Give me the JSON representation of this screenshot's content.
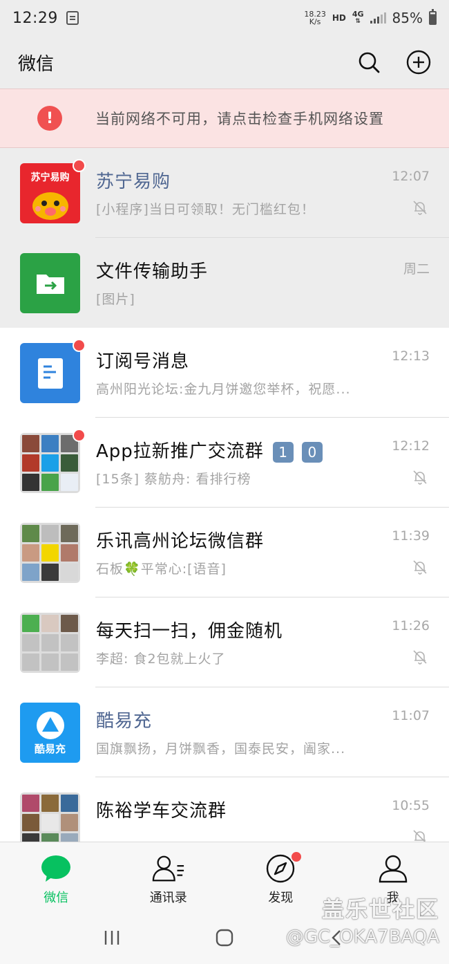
{
  "status_bar": {
    "time": "12:29",
    "net_speed_value": "18.23",
    "net_speed_unit": "K/s",
    "hd": "HD",
    "network": "4G",
    "battery": "85%"
  },
  "header": {
    "title": "微信",
    "search_icon": "search-icon",
    "add_icon": "plus-circle-icon"
  },
  "alert": {
    "icon": "exclamation-icon",
    "color": "#f05151",
    "text": "当前网络不可用，请点击检查手机网络设置"
  },
  "chats": [
    {
      "name": "苏宁易购",
      "preview": "[小程序]当日可领取！无门槛红包！",
      "time": "12:07",
      "pinned": true,
      "unread_dot": true,
      "muted": true,
      "name_color": "blue",
      "avatar_text": "苏宁易购",
      "avatar_color": "#e8262d"
    },
    {
      "name": "文件传输助手",
      "preview": "[图片]",
      "time": "周二",
      "pinned": true,
      "unread_dot": false,
      "muted": false,
      "avatar_color": "#2ba245"
    },
    {
      "name": "订阅号消息",
      "preview": "高州阳光论坛:金九月饼邀您举杯，祝愿...",
      "time": "12:13",
      "pinned": false,
      "unread_dot": true,
      "muted": false,
      "avatar_color": "#2f83dd"
    },
    {
      "name": "App拉新推广交流群",
      "badges": [
        "1",
        "0"
      ],
      "preview": "[15条] 蔡舫舟: 看排行榜",
      "time": "12:12",
      "pinned": false,
      "unread_dot": true,
      "muted": true
    },
    {
      "name": "乐讯高州论坛微信群",
      "preview_before": "石板",
      "preview_after": "平常心:[语音]",
      "time": "11:39",
      "pinned": false,
      "unread_dot": false,
      "muted": true
    },
    {
      "name": "每天扫一扫，佣金随机",
      "preview": "李超: 食2包就上火了",
      "time": "11:26",
      "pinned": false,
      "unread_dot": false,
      "muted": true
    },
    {
      "name": "酷易充",
      "preview": "国旗飘扬，月饼飘香，国泰民安，阖家...",
      "time": "11:07",
      "pinned": false,
      "unread_dot": false,
      "muted": false,
      "name_color": "blue",
      "avatar_text": "酷易充",
      "avatar_color": "#1e9bf0"
    },
    {
      "name": "陈裕学车交流群",
      "preview": "",
      "time": "10:55",
      "pinned": false,
      "unread_dot": false,
      "muted": true
    }
  ],
  "nav": {
    "items": [
      {
        "label": "微信",
        "icon": "chat-bubble-icon",
        "active": true
      },
      {
        "label": "通讯录",
        "icon": "contacts-icon",
        "active": false
      },
      {
        "label": "发现",
        "icon": "compass-icon",
        "active": false,
        "dot": true
      },
      {
        "label": "我",
        "icon": "person-icon",
        "active": false
      }
    ],
    "active_color": "#07c160"
  },
  "system_nav": {
    "recent_icon": "recent-apps-icon",
    "home_icon": "home-icon",
    "back_icon": "back-icon"
  },
  "watermark": {
    "brand": "盖乐世社区",
    "handle": "@GC_OKA7BAQA"
  }
}
